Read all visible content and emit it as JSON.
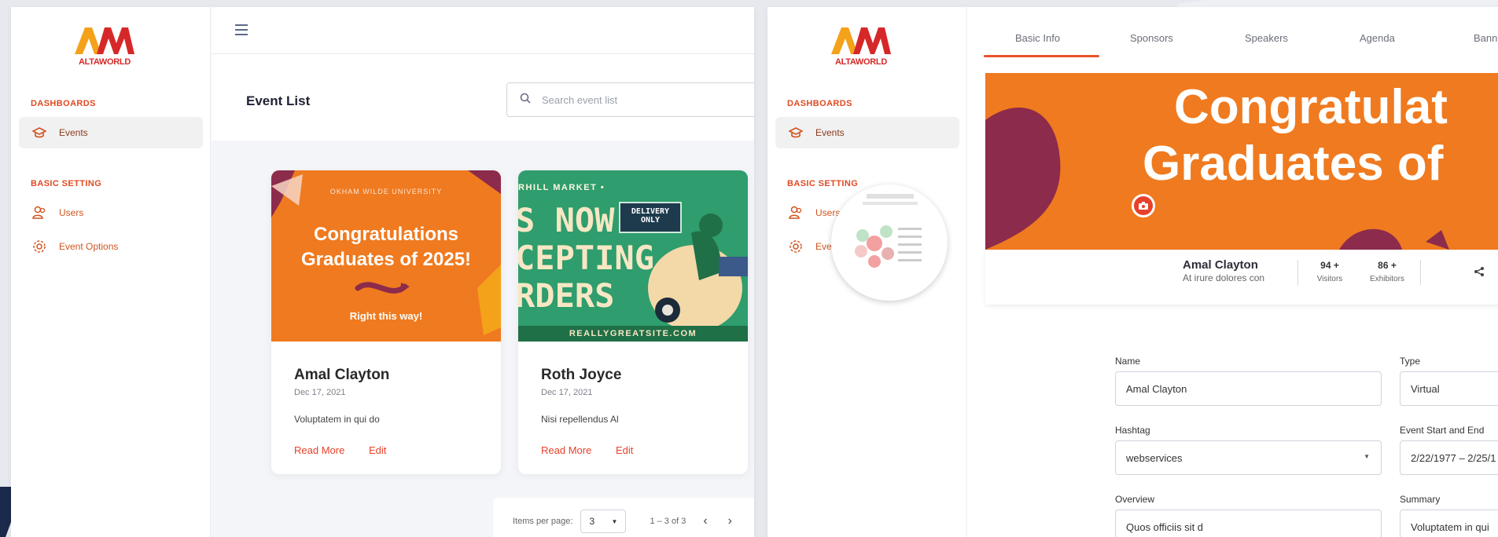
{
  "brand": {
    "logo_text": "ALTAWORLD"
  },
  "sidebar": {
    "sections": [
      {
        "heading": "DASHBOARDS",
        "items": [
          {
            "label": "Events"
          }
        ]
      },
      {
        "heading": "BASIC SETTING",
        "items": [
          {
            "label": "Users"
          },
          {
            "label": "Event Options"
          }
        ]
      }
    ]
  },
  "event_list": {
    "title": "Event List",
    "search_placeholder": "Search event list",
    "cards": [
      {
        "banner": {
          "kicker": "OKHAM WILDE UNIVERSITY",
          "headline_1": "Congratulations",
          "headline_2": "Graduates of 2025!",
          "cta": "Right this way!"
        },
        "title": "Amal Clayton",
        "date": "Dec 17, 2021",
        "description": "Voluptatem in qui do",
        "read_more": "Read More",
        "edit": "Edit"
      },
      {
        "banner": {
          "kicker": "RHILL MARKET •",
          "line_1": "S NOW",
          "line_2": "CEPTING",
          "line_3": "RDERS",
          "sign_1": "DELIVERY",
          "sign_2": "ONLY",
          "footer": "REALLYGREATSITE.COM"
        },
        "title": "Roth Joyce",
        "date": "Dec 17, 2021",
        "description": "Nisi repellendus Al",
        "read_more": "Read More",
        "edit": "Edit"
      }
    ],
    "pagination": {
      "items_per_page_label": "Items per page:",
      "items_per_page": "3",
      "range": "1 – 3 of 3"
    }
  },
  "event_detail": {
    "tabs": [
      "Basic Info",
      "Sponsors",
      "Speakers",
      "Agenda",
      "Banne"
    ],
    "active_tab": "Basic Info",
    "hero": {
      "line_1": "Congratulat",
      "line_2": "Graduates of"
    },
    "profile": {
      "name": "Amal Clayton",
      "subtitle": "At irure dolores con"
    },
    "stats": [
      {
        "value": "94 +",
        "label": "Visitors"
      },
      {
        "value": "86 +",
        "label": "Exhibitors"
      }
    ],
    "form": {
      "name": {
        "label": "Name",
        "value": "Amal Clayton"
      },
      "type": {
        "label": "Type",
        "value": "Virtual"
      },
      "hashtag": {
        "label": "Hashtag",
        "value": "webservices"
      },
      "dates": {
        "label": "Event Start and End",
        "value": "2/22/1977 – 2/25/1"
      },
      "overview": {
        "label": "Overview",
        "value": "Quos officiis sit d"
      },
      "summary": {
        "label": "Summary",
        "value": "Voluptatem in qui"
      }
    }
  },
  "colors": {
    "accent": "#e8402a",
    "orange": "#f07a1f",
    "green": "#2f9d6d",
    "dark_green": "#1f6f47"
  }
}
